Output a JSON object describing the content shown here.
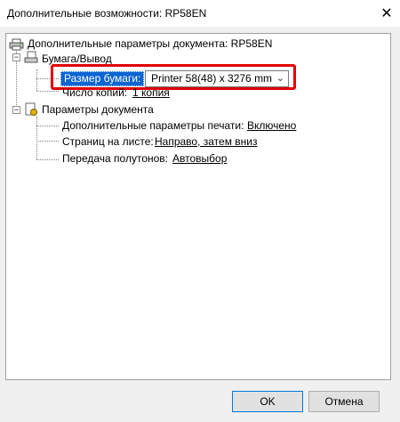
{
  "window": {
    "title": "Дополнительные возможности: RP58EN",
    "close_glyph": "✕"
  },
  "tree": {
    "root_label": "Дополнительные параметры документа: RP58EN",
    "paper_output": {
      "label": "Бумага/Вывод",
      "expander": "−",
      "paper_size": {
        "label": "Размер бумаги:",
        "value": "Printer 58(48) x 3276 mm"
      },
      "copies": {
        "label": "Число копий:",
        "value": "1 копия"
      }
    },
    "document_params": {
      "label": "Параметры документа",
      "expander": "−",
      "advanced_print": {
        "label": "Дополнительные параметры печати:",
        "value": "Включено"
      },
      "pages_per_sheet": {
        "label": "Страниц на листе:",
        "value": "Направо, затем вниз"
      },
      "halftone": {
        "label": "Передача полутонов:",
        "value": "Автовыбор"
      }
    }
  },
  "buttons": {
    "ok": "OK",
    "cancel": "Отмена"
  },
  "colors": {
    "selection": "#0a64d2",
    "highlight_border": "#e00000",
    "ok_border": "#0078d7"
  },
  "icons": {
    "root": "printer-icon",
    "paper_output": "paper-tray-icon",
    "document_params": "document-settings-icon"
  }
}
